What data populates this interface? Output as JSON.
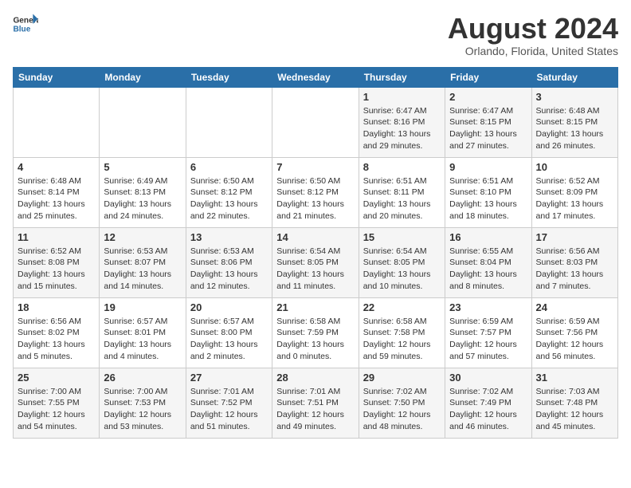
{
  "logo": {
    "line1": "General",
    "line2": "Blue"
  },
  "title": "August 2024",
  "subtitle": "Orlando, Florida, United States",
  "days_of_week": [
    "Sunday",
    "Monday",
    "Tuesday",
    "Wednesday",
    "Thursday",
    "Friday",
    "Saturday"
  ],
  "weeks": [
    [
      {
        "day": "",
        "info": ""
      },
      {
        "day": "",
        "info": ""
      },
      {
        "day": "",
        "info": ""
      },
      {
        "day": "",
        "info": ""
      },
      {
        "day": "1",
        "info": "Sunrise: 6:47 AM\nSunset: 8:16 PM\nDaylight: 13 hours\nand 29 minutes."
      },
      {
        "day": "2",
        "info": "Sunrise: 6:47 AM\nSunset: 8:15 PM\nDaylight: 13 hours\nand 27 minutes."
      },
      {
        "day": "3",
        "info": "Sunrise: 6:48 AM\nSunset: 8:15 PM\nDaylight: 13 hours\nand 26 minutes."
      }
    ],
    [
      {
        "day": "4",
        "info": "Sunrise: 6:48 AM\nSunset: 8:14 PM\nDaylight: 13 hours\nand 25 minutes."
      },
      {
        "day": "5",
        "info": "Sunrise: 6:49 AM\nSunset: 8:13 PM\nDaylight: 13 hours\nand 24 minutes."
      },
      {
        "day": "6",
        "info": "Sunrise: 6:50 AM\nSunset: 8:12 PM\nDaylight: 13 hours\nand 22 minutes."
      },
      {
        "day": "7",
        "info": "Sunrise: 6:50 AM\nSunset: 8:12 PM\nDaylight: 13 hours\nand 21 minutes."
      },
      {
        "day": "8",
        "info": "Sunrise: 6:51 AM\nSunset: 8:11 PM\nDaylight: 13 hours\nand 20 minutes."
      },
      {
        "day": "9",
        "info": "Sunrise: 6:51 AM\nSunset: 8:10 PM\nDaylight: 13 hours\nand 18 minutes."
      },
      {
        "day": "10",
        "info": "Sunrise: 6:52 AM\nSunset: 8:09 PM\nDaylight: 13 hours\nand 17 minutes."
      }
    ],
    [
      {
        "day": "11",
        "info": "Sunrise: 6:52 AM\nSunset: 8:08 PM\nDaylight: 13 hours\nand 15 minutes."
      },
      {
        "day": "12",
        "info": "Sunrise: 6:53 AM\nSunset: 8:07 PM\nDaylight: 13 hours\nand 14 minutes."
      },
      {
        "day": "13",
        "info": "Sunrise: 6:53 AM\nSunset: 8:06 PM\nDaylight: 13 hours\nand 12 minutes."
      },
      {
        "day": "14",
        "info": "Sunrise: 6:54 AM\nSunset: 8:05 PM\nDaylight: 13 hours\nand 11 minutes."
      },
      {
        "day": "15",
        "info": "Sunrise: 6:54 AM\nSunset: 8:05 PM\nDaylight: 13 hours\nand 10 minutes."
      },
      {
        "day": "16",
        "info": "Sunrise: 6:55 AM\nSunset: 8:04 PM\nDaylight: 13 hours\nand 8 minutes."
      },
      {
        "day": "17",
        "info": "Sunrise: 6:56 AM\nSunset: 8:03 PM\nDaylight: 13 hours\nand 7 minutes."
      }
    ],
    [
      {
        "day": "18",
        "info": "Sunrise: 6:56 AM\nSunset: 8:02 PM\nDaylight: 13 hours\nand 5 minutes."
      },
      {
        "day": "19",
        "info": "Sunrise: 6:57 AM\nSunset: 8:01 PM\nDaylight: 13 hours\nand 4 minutes."
      },
      {
        "day": "20",
        "info": "Sunrise: 6:57 AM\nSunset: 8:00 PM\nDaylight: 13 hours\nand 2 minutes."
      },
      {
        "day": "21",
        "info": "Sunrise: 6:58 AM\nSunset: 7:59 PM\nDaylight: 13 hours\nand 0 minutes."
      },
      {
        "day": "22",
        "info": "Sunrise: 6:58 AM\nSunset: 7:58 PM\nDaylight: 12 hours\nand 59 minutes."
      },
      {
        "day": "23",
        "info": "Sunrise: 6:59 AM\nSunset: 7:57 PM\nDaylight: 12 hours\nand 57 minutes."
      },
      {
        "day": "24",
        "info": "Sunrise: 6:59 AM\nSunset: 7:56 PM\nDaylight: 12 hours\nand 56 minutes."
      }
    ],
    [
      {
        "day": "25",
        "info": "Sunrise: 7:00 AM\nSunset: 7:55 PM\nDaylight: 12 hours\nand 54 minutes."
      },
      {
        "day": "26",
        "info": "Sunrise: 7:00 AM\nSunset: 7:53 PM\nDaylight: 12 hours\nand 53 minutes."
      },
      {
        "day": "27",
        "info": "Sunrise: 7:01 AM\nSunset: 7:52 PM\nDaylight: 12 hours\nand 51 minutes."
      },
      {
        "day": "28",
        "info": "Sunrise: 7:01 AM\nSunset: 7:51 PM\nDaylight: 12 hours\nand 49 minutes."
      },
      {
        "day": "29",
        "info": "Sunrise: 7:02 AM\nSunset: 7:50 PM\nDaylight: 12 hours\nand 48 minutes."
      },
      {
        "day": "30",
        "info": "Sunrise: 7:02 AM\nSunset: 7:49 PM\nDaylight: 12 hours\nand 46 minutes."
      },
      {
        "day": "31",
        "info": "Sunrise: 7:03 AM\nSunset: 7:48 PM\nDaylight: 12 hours\nand 45 minutes."
      }
    ]
  ]
}
